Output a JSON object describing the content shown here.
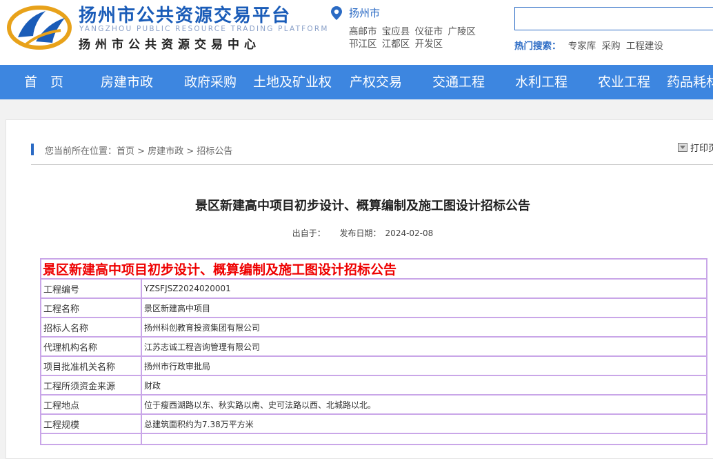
{
  "header": {
    "title": "扬州市公共资源交易平台",
    "title_en": "YANGZHOU PUBLIC RESOURCE TRADING PLATFORM",
    "subtitle": "扬州市公共资源交易中心",
    "location": {
      "city": "扬州市",
      "districts_row1": [
        "高邮市",
        "宝应县",
        "仪征市",
        "广陵区"
      ],
      "districts_row2": [
        "邗江区",
        "江都区",
        "开发区"
      ]
    },
    "search": {
      "value": "",
      "placeholder": ""
    },
    "hot_search": {
      "label": "热门搜索：",
      "items": [
        "专家库",
        "采购",
        "工程建设"
      ]
    }
  },
  "nav": {
    "items": [
      "首　页",
      "房建市政",
      "政府采购",
      "土地及矿业权",
      "产权交易",
      "交通工程",
      "水利工程",
      "农业工程",
      "药品耗材"
    ]
  },
  "breadcrumb": {
    "prefix": "您当前所在位置：",
    "items": [
      "首页",
      "房建市政",
      "招标公告"
    ],
    "separator": " > "
  },
  "print_label": "打印页",
  "article": {
    "title": "景区新建高中项目初步设计、概算编制及施工图设计招标公告",
    "source_label": "出自于：",
    "date_label": "发布日期：",
    "date": "2024-02-08"
  },
  "table": {
    "header": "景区新建高中项目初步设计、概算编制及施工图设计招标公告",
    "rows": [
      {
        "key": "工程编号",
        "value": "YZSFJSZ2024020001"
      },
      {
        "key": "工程名称",
        "value": "景区新建高中项目"
      },
      {
        "key": "招标人名称",
        "value": "扬州科创教育投资集团有限公司"
      },
      {
        "key": "代理机构名称",
        "value": "江苏志诚工程咨询管理有限公司"
      },
      {
        "key": "项目批准机关名称",
        "value": "扬州市行政审批局"
      },
      {
        "key": "工程所须资金来源",
        "value": "财政"
      },
      {
        "key": "工程地点",
        "value": "位于瘦西湖路以东、秋实路以南、史可法路以西、北城路以北。"
      },
      {
        "key": "工程规模",
        "value": "总建筑面积约为7.38万平方米"
      }
    ]
  },
  "colors": {
    "brand_blue": "#1a5cb8",
    "nav_bg": "#3d86e0",
    "table_border": "#c9a6e8",
    "table_header_red": "#ee0000"
  },
  "icons": [
    "logo-mark-icon",
    "location-pin-icon",
    "print-icon"
  ]
}
